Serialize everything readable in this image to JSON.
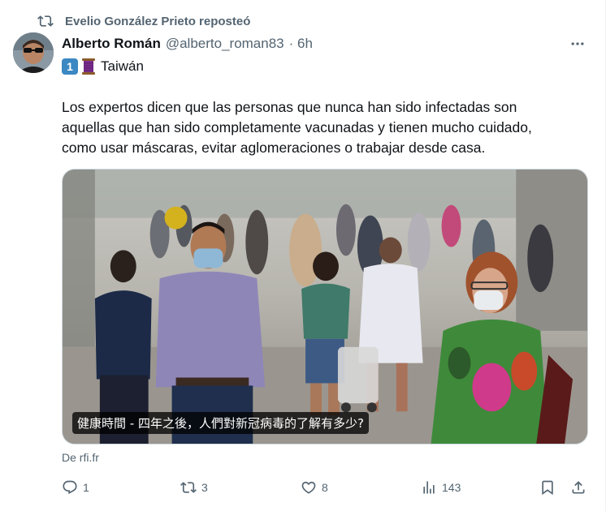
{
  "repost": {
    "text": "Evelio González Prieto reposteó",
    "icon": "repost-icon"
  },
  "author": {
    "name": "Alberto Román",
    "handle": "@alberto_roman83",
    "time": "· 6h"
  },
  "post": {
    "line1_num": "1",
    "line1_text": "Taiwán",
    "body": "Los expertos dicen que las personas que nunca han sido infectadas son\naquellas que han sido completamente vacunadas y tienen mucho cuidado,\ncomo usar máscaras, evitar aglomeraciones o trabajar desde casa."
  },
  "media": {
    "caption": "健康時間 - 四年之後，人們對新冠病毒的了解有多少?"
  },
  "source": "De rfi.fr",
  "actions": {
    "replies": "1",
    "reposts": "3",
    "likes": "8",
    "views": "143"
  },
  "colors": {
    "muted": "#536471",
    "text": "#0f1419"
  }
}
